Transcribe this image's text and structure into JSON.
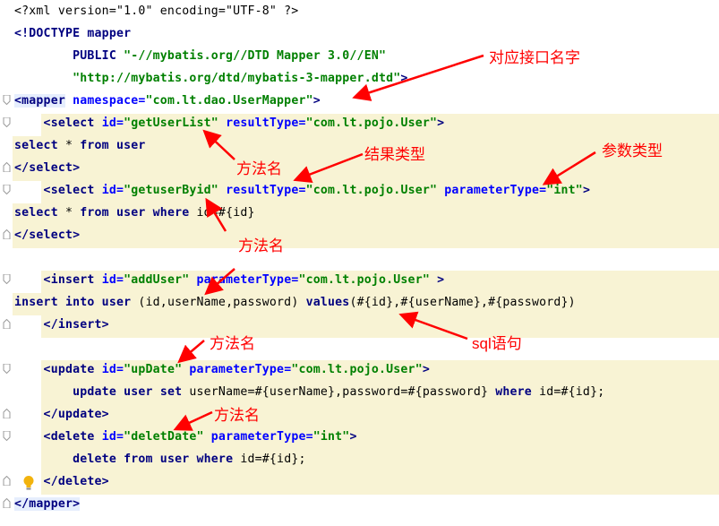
{
  "editor": {
    "lines": [
      {
        "segments": [
          {
            "t": "<?xml version=\"1.0\" encoding=\"UTF-8\" ?>",
            "c": "plain"
          }
        ]
      },
      {
        "segments": [
          {
            "t": "<!DOCTYPE mapper",
            "c": "doct"
          }
        ]
      },
      {
        "segments": [
          {
            "t": "        PUBLIC ",
            "c": "doct"
          },
          {
            "t": "\"-//mybatis.org//DTD Mapper 3.0//EN\"",
            "c": "str"
          }
        ]
      },
      {
        "segments": [
          {
            "t": "        \"http://mybatis.org/dtd/mybatis-3-mapper.dtd\"",
            "c": "str"
          },
          {
            "t": ">",
            "c": "doct"
          }
        ]
      },
      {
        "segments": [
          {
            "t": "<mapper",
            "c": "tag tagbg"
          },
          {
            "t": " namespace=",
            "c": "attr"
          },
          {
            "t": "\"com.lt.dao.UserMapper\"",
            "c": "str"
          },
          {
            "t": ">",
            "c": "tag"
          }
        ]
      },
      {
        "segments": [
          {
            "t": "    <select ",
            "c": "tag"
          },
          {
            "t": "id=",
            "c": "attr"
          },
          {
            "t": "\"getUserList\"",
            "c": "str"
          },
          {
            "t": " resultType=",
            "c": "attr"
          },
          {
            "t": "\"com.lt.pojo.User\"",
            "c": "str"
          },
          {
            "t": ">",
            "c": "tag"
          }
        ]
      },
      {
        "segments": [
          {
            "t": "select",
            "c": "kw"
          },
          {
            "t": " * ",
            "c": "plain"
          },
          {
            "t": "from",
            "c": "kw"
          },
          {
            "t": " user",
            "c": "kw"
          }
        ]
      },
      {
        "segments": [
          {
            "t": "</select>",
            "c": "tag"
          }
        ]
      },
      {
        "segments": [
          {
            "t": "    <select ",
            "c": "tag"
          },
          {
            "t": "id=",
            "c": "attr"
          },
          {
            "t": "\"getuserByid\"",
            "c": "str"
          },
          {
            "t": " resultType=",
            "c": "attr"
          },
          {
            "t": "\"com.lt.pojo.User\"",
            "c": "str"
          },
          {
            "t": " parameterType=",
            "c": "attr"
          },
          {
            "t": "\"int\"",
            "c": "str"
          },
          {
            "t": ">",
            "c": "tag"
          }
        ]
      },
      {
        "segments": [
          {
            "t": "select",
            "c": "kw"
          },
          {
            "t": " * ",
            "c": "plain"
          },
          {
            "t": "from",
            "c": "kw"
          },
          {
            "t": " user ",
            "c": "kw"
          },
          {
            "t": "where",
            "c": "kw"
          },
          {
            "t": " id=#{id}",
            "c": "plain"
          }
        ]
      },
      {
        "segments": [
          {
            "t": "</select>",
            "c": "tag"
          }
        ]
      },
      {
        "segments": []
      },
      {
        "segments": [
          {
            "t": "    <insert ",
            "c": "tag"
          },
          {
            "t": "id=",
            "c": "attr"
          },
          {
            "t": "\"addUser\"",
            "c": "str"
          },
          {
            "t": " parameterType=",
            "c": "attr"
          },
          {
            "t": "\"com.lt.pojo.User\"",
            "c": "str"
          },
          {
            "t": " >",
            "c": "tag"
          }
        ]
      },
      {
        "segments": [
          {
            "t": "insert into",
            "c": "kw"
          },
          {
            "t": " user ",
            "c": "kw"
          },
          {
            "t": "(id,userName,password) ",
            "c": "plain"
          },
          {
            "t": "values",
            "c": "kw"
          },
          {
            "t": "(#{id},#{userName},#{password})",
            "c": "plain"
          }
        ]
      },
      {
        "segments": [
          {
            "t": "    </insert>",
            "c": "tag"
          }
        ]
      },
      {
        "segments": []
      },
      {
        "segments": [
          {
            "t": "    <update ",
            "c": "tag"
          },
          {
            "t": "id=",
            "c": "attr"
          },
          {
            "t": "\"upDate\"",
            "c": "str"
          },
          {
            "t": " parameterType=",
            "c": "attr"
          },
          {
            "t": "\"com.lt.pojo.User\"",
            "c": "str"
          },
          {
            "t": ">",
            "c": "tag"
          }
        ]
      },
      {
        "segments": [
          {
            "t": "        update",
            "c": "kw"
          },
          {
            "t": " user ",
            "c": "kw"
          },
          {
            "t": "set",
            "c": "kw"
          },
          {
            "t": " userName=#{userName},password=#{password} ",
            "c": "plain"
          },
          {
            "t": "where",
            "c": "kw"
          },
          {
            "t": " id=#{id};",
            "c": "plain"
          }
        ]
      },
      {
        "segments": [
          {
            "t": "    </update>",
            "c": "tag"
          }
        ]
      },
      {
        "segments": [
          {
            "t": "    <delete ",
            "c": "tag"
          },
          {
            "t": "id=",
            "c": "attr"
          },
          {
            "t": "\"deletDate\"",
            "c": "str"
          },
          {
            "t": " parameterType=",
            "c": "attr"
          },
          {
            "t": "\"int\"",
            "c": "str"
          },
          {
            "t": ">",
            "c": "tag"
          }
        ]
      },
      {
        "segments": [
          {
            "t": "        delete",
            "c": "kw"
          },
          {
            "t": " from",
            "c": "kw"
          },
          {
            "t": " user",
            "c": "kw"
          },
          {
            "t": " where",
            "c": "kw"
          },
          {
            "t": " id=#{id};",
            "c": "plain"
          }
        ]
      },
      {
        "segments": [
          {
            "t": "    </delete>",
            "c": "tag"
          }
        ]
      },
      {
        "segments": [
          {
            "t": "</mapper>",
            "c": "tag tagbg"
          }
        ]
      }
    ]
  },
  "annotations": {
    "interface_name": "对应接口名字",
    "method_name_1": "方法名",
    "result_type": "结果类型",
    "param_type": "参数类型",
    "method_name_2": "方法名",
    "sql_statement": "sql语句",
    "method_name_3": "方法名",
    "method_name_4": "方法名"
  },
  "colors": {
    "highlight": "#f8f3d4",
    "annotation": "#ff0000",
    "tag": "#000080",
    "attribute": "#0000ff",
    "string": "#008000"
  }
}
